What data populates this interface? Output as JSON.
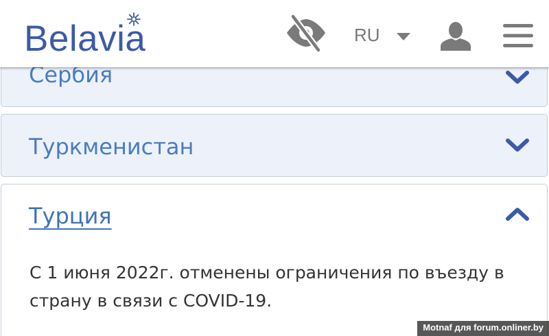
{
  "header": {
    "logo_text": "Belavia",
    "language": "RU",
    "icons": {
      "accessibility": "eye-slash-icon",
      "language_caret": "caret-down-icon",
      "account": "user-icon",
      "menu": "hamburger-menu-icon"
    }
  },
  "accordion": {
    "items": [
      {
        "title": "Сербия",
        "expanded": false,
        "icon": "chevron-down-icon"
      },
      {
        "title": "Туркменистан",
        "expanded": false,
        "icon": "chevron-down-icon"
      },
      {
        "title": "Турция",
        "expanded": true,
        "icon": "chevron-up-icon",
        "body": "С 1 июня 2022г. отменены ограничения по въезду в страну в связи с COVID-19."
      }
    ]
  },
  "watermark": "Motnaf для forum.onliner.by",
  "colors": {
    "brand": "#3d5aa8",
    "title_link": "#4a7dc1",
    "collapsed_bg": "#edf1fa",
    "icon_grey": "#787878"
  }
}
